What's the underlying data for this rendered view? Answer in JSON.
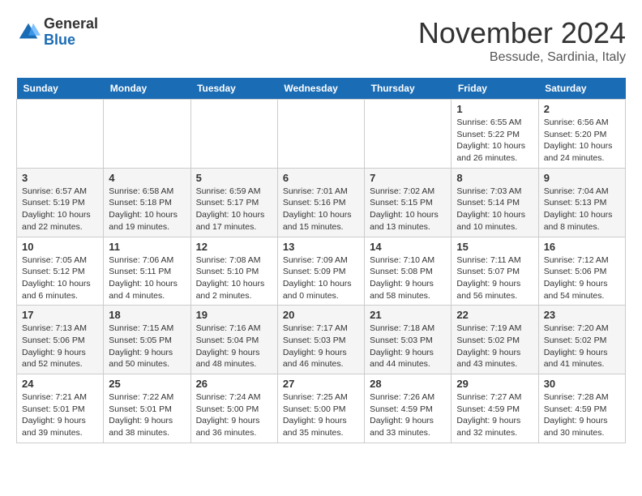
{
  "logo": {
    "general": "General",
    "blue": "Blue"
  },
  "title": "November 2024",
  "location": "Bessude, Sardinia, Italy",
  "weekdays": [
    "Sunday",
    "Monday",
    "Tuesday",
    "Wednesday",
    "Thursday",
    "Friday",
    "Saturday"
  ],
  "weeks": [
    [
      {
        "day": "",
        "info": ""
      },
      {
        "day": "",
        "info": ""
      },
      {
        "day": "",
        "info": ""
      },
      {
        "day": "",
        "info": ""
      },
      {
        "day": "",
        "info": ""
      },
      {
        "day": "1",
        "info": "Sunrise: 6:55 AM\nSunset: 5:22 PM\nDaylight: 10 hours\nand 26 minutes."
      },
      {
        "day": "2",
        "info": "Sunrise: 6:56 AM\nSunset: 5:20 PM\nDaylight: 10 hours\nand 24 minutes."
      }
    ],
    [
      {
        "day": "3",
        "info": "Sunrise: 6:57 AM\nSunset: 5:19 PM\nDaylight: 10 hours\nand 22 minutes."
      },
      {
        "day": "4",
        "info": "Sunrise: 6:58 AM\nSunset: 5:18 PM\nDaylight: 10 hours\nand 19 minutes."
      },
      {
        "day": "5",
        "info": "Sunrise: 6:59 AM\nSunset: 5:17 PM\nDaylight: 10 hours\nand 17 minutes."
      },
      {
        "day": "6",
        "info": "Sunrise: 7:01 AM\nSunset: 5:16 PM\nDaylight: 10 hours\nand 15 minutes."
      },
      {
        "day": "7",
        "info": "Sunrise: 7:02 AM\nSunset: 5:15 PM\nDaylight: 10 hours\nand 13 minutes."
      },
      {
        "day": "8",
        "info": "Sunrise: 7:03 AM\nSunset: 5:14 PM\nDaylight: 10 hours\nand 10 minutes."
      },
      {
        "day": "9",
        "info": "Sunrise: 7:04 AM\nSunset: 5:13 PM\nDaylight: 10 hours\nand 8 minutes."
      }
    ],
    [
      {
        "day": "10",
        "info": "Sunrise: 7:05 AM\nSunset: 5:12 PM\nDaylight: 10 hours\nand 6 minutes."
      },
      {
        "day": "11",
        "info": "Sunrise: 7:06 AM\nSunset: 5:11 PM\nDaylight: 10 hours\nand 4 minutes."
      },
      {
        "day": "12",
        "info": "Sunrise: 7:08 AM\nSunset: 5:10 PM\nDaylight: 10 hours\nand 2 minutes."
      },
      {
        "day": "13",
        "info": "Sunrise: 7:09 AM\nSunset: 5:09 PM\nDaylight: 10 hours\nand 0 minutes."
      },
      {
        "day": "14",
        "info": "Sunrise: 7:10 AM\nSunset: 5:08 PM\nDaylight: 9 hours\nand 58 minutes."
      },
      {
        "day": "15",
        "info": "Sunrise: 7:11 AM\nSunset: 5:07 PM\nDaylight: 9 hours\nand 56 minutes."
      },
      {
        "day": "16",
        "info": "Sunrise: 7:12 AM\nSunset: 5:06 PM\nDaylight: 9 hours\nand 54 minutes."
      }
    ],
    [
      {
        "day": "17",
        "info": "Sunrise: 7:13 AM\nSunset: 5:06 PM\nDaylight: 9 hours\nand 52 minutes."
      },
      {
        "day": "18",
        "info": "Sunrise: 7:15 AM\nSunset: 5:05 PM\nDaylight: 9 hours\nand 50 minutes."
      },
      {
        "day": "19",
        "info": "Sunrise: 7:16 AM\nSunset: 5:04 PM\nDaylight: 9 hours\nand 48 minutes."
      },
      {
        "day": "20",
        "info": "Sunrise: 7:17 AM\nSunset: 5:03 PM\nDaylight: 9 hours\nand 46 minutes."
      },
      {
        "day": "21",
        "info": "Sunrise: 7:18 AM\nSunset: 5:03 PM\nDaylight: 9 hours\nand 44 minutes."
      },
      {
        "day": "22",
        "info": "Sunrise: 7:19 AM\nSunset: 5:02 PM\nDaylight: 9 hours\nand 43 minutes."
      },
      {
        "day": "23",
        "info": "Sunrise: 7:20 AM\nSunset: 5:02 PM\nDaylight: 9 hours\nand 41 minutes."
      }
    ],
    [
      {
        "day": "24",
        "info": "Sunrise: 7:21 AM\nSunset: 5:01 PM\nDaylight: 9 hours\nand 39 minutes."
      },
      {
        "day": "25",
        "info": "Sunrise: 7:22 AM\nSunset: 5:01 PM\nDaylight: 9 hours\nand 38 minutes."
      },
      {
        "day": "26",
        "info": "Sunrise: 7:24 AM\nSunset: 5:00 PM\nDaylight: 9 hours\nand 36 minutes."
      },
      {
        "day": "27",
        "info": "Sunrise: 7:25 AM\nSunset: 5:00 PM\nDaylight: 9 hours\nand 35 minutes."
      },
      {
        "day": "28",
        "info": "Sunrise: 7:26 AM\nSunset: 4:59 PM\nDaylight: 9 hours\nand 33 minutes."
      },
      {
        "day": "29",
        "info": "Sunrise: 7:27 AM\nSunset: 4:59 PM\nDaylight: 9 hours\nand 32 minutes."
      },
      {
        "day": "30",
        "info": "Sunrise: 7:28 AM\nSunset: 4:59 PM\nDaylight: 9 hours\nand 30 minutes."
      }
    ]
  ]
}
